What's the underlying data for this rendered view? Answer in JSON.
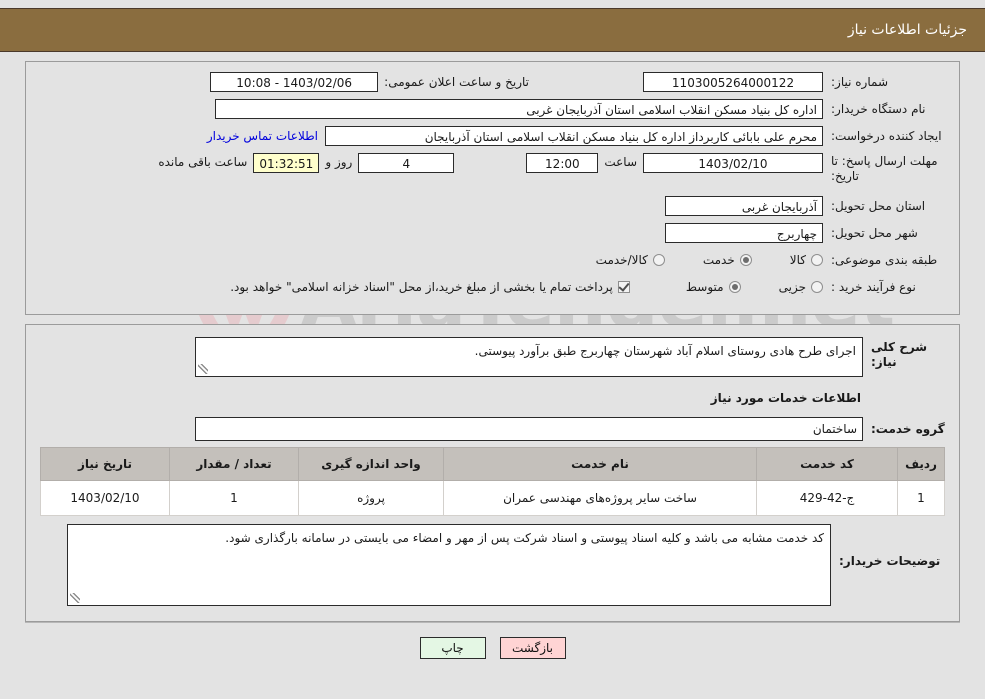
{
  "header": {
    "title": "جزئیات اطلاعات نیاز",
    "bar_color": "#8a6d3f"
  },
  "watermark": {
    "text": "AriaTender.net"
  },
  "need_info": {
    "need_number_label": "شماره نیاز:",
    "need_number_value": "1103005264000122",
    "announce_datetime_label": "تاریخ و ساعت اعلان عمومی:",
    "announce_datetime_value": "1403/02/06 - 10:08",
    "buyer_org_label": "نام دستگاه خریدار:",
    "buyer_org_value": "اداره کل بنیاد مسکن انقلاب اسلامی استان آذربایجان غربی",
    "creator_label": "ایجاد کننده درخواست:",
    "creator_value": "محرم علی بابائی کاربرداز اداره کل بنیاد مسکن انقلاب اسلامی استان آذربایجان",
    "contact_link": "اطلاعات تماس خریدار",
    "deadline_label": "مهلت ارسال پاسخ: تا تاریخ:",
    "deadline_date": "1403/02/10",
    "deadline_hour_label": "ساعت",
    "deadline_hour": "12:00",
    "remaining_days": "4",
    "remaining_days_label": "روز و",
    "remaining_time": "01:32:51",
    "remaining_time_label": "ساعت باقی مانده",
    "province_label": "استان محل تحویل:",
    "province_value": "آذربایجان غربی",
    "city_label": "شهر محل تحویل:",
    "city_value": "چهاربرج",
    "category_label": "طبقه بندی موضوعی:",
    "category_options": [
      {
        "label": "کالا",
        "selected": false
      },
      {
        "label": "خدمت",
        "selected": true
      },
      {
        "label": "کالا/خدمت",
        "selected": false
      }
    ],
    "process_label": "نوع فرآیند خرید :",
    "process_options": [
      {
        "label": "جزیی",
        "selected": false
      },
      {
        "label": "متوسط",
        "selected": true
      }
    ],
    "treasury_checkbox_checked": true,
    "treasury_text": "پرداخت تمام یا بخشی از مبلغ خرید،از محل \"اسناد خزانه اسلامی\" خواهد بود."
  },
  "description": {
    "general_label": "شرح کلی نیاز:",
    "general_value": "اجرای طرح هادی روستای اسلام آباد شهرستان چهاربرج طبق برآورد پیوستی.",
    "services_section_title": "اطلاعات خدمات مورد نیاز",
    "service_group_label": "گروه خدمت:",
    "service_group_value": "ساختمان"
  },
  "table": {
    "columns": [
      "ردیف",
      "کد خدمت",
      "نام خدمت",
      "واحد اندازه گیری",
      "تعداد / مقدار",
      "تاریخ نیاز"
    ],
    "rows": [
      [
        "1",
        "ج-42-429",
        "ساخت سایر پروژه‌های مهندسی عمران",
        "پروژه",
        "1",
        "1403/02/10"
      ]
    ]
  },
  "buyer_notes": {
    "label": "توضیحات خریدار:",
    "value": "کد خدمت مشابه می باشد و کلیه اسناد پیوستی و اسناد شرکت پس از مهر و امضاء می بایستی در سامانه بارگذاری شود."
  },
  "footer": {
    "back_label": "بازگشت",
    "print_label": "چاپ"
  }
}
